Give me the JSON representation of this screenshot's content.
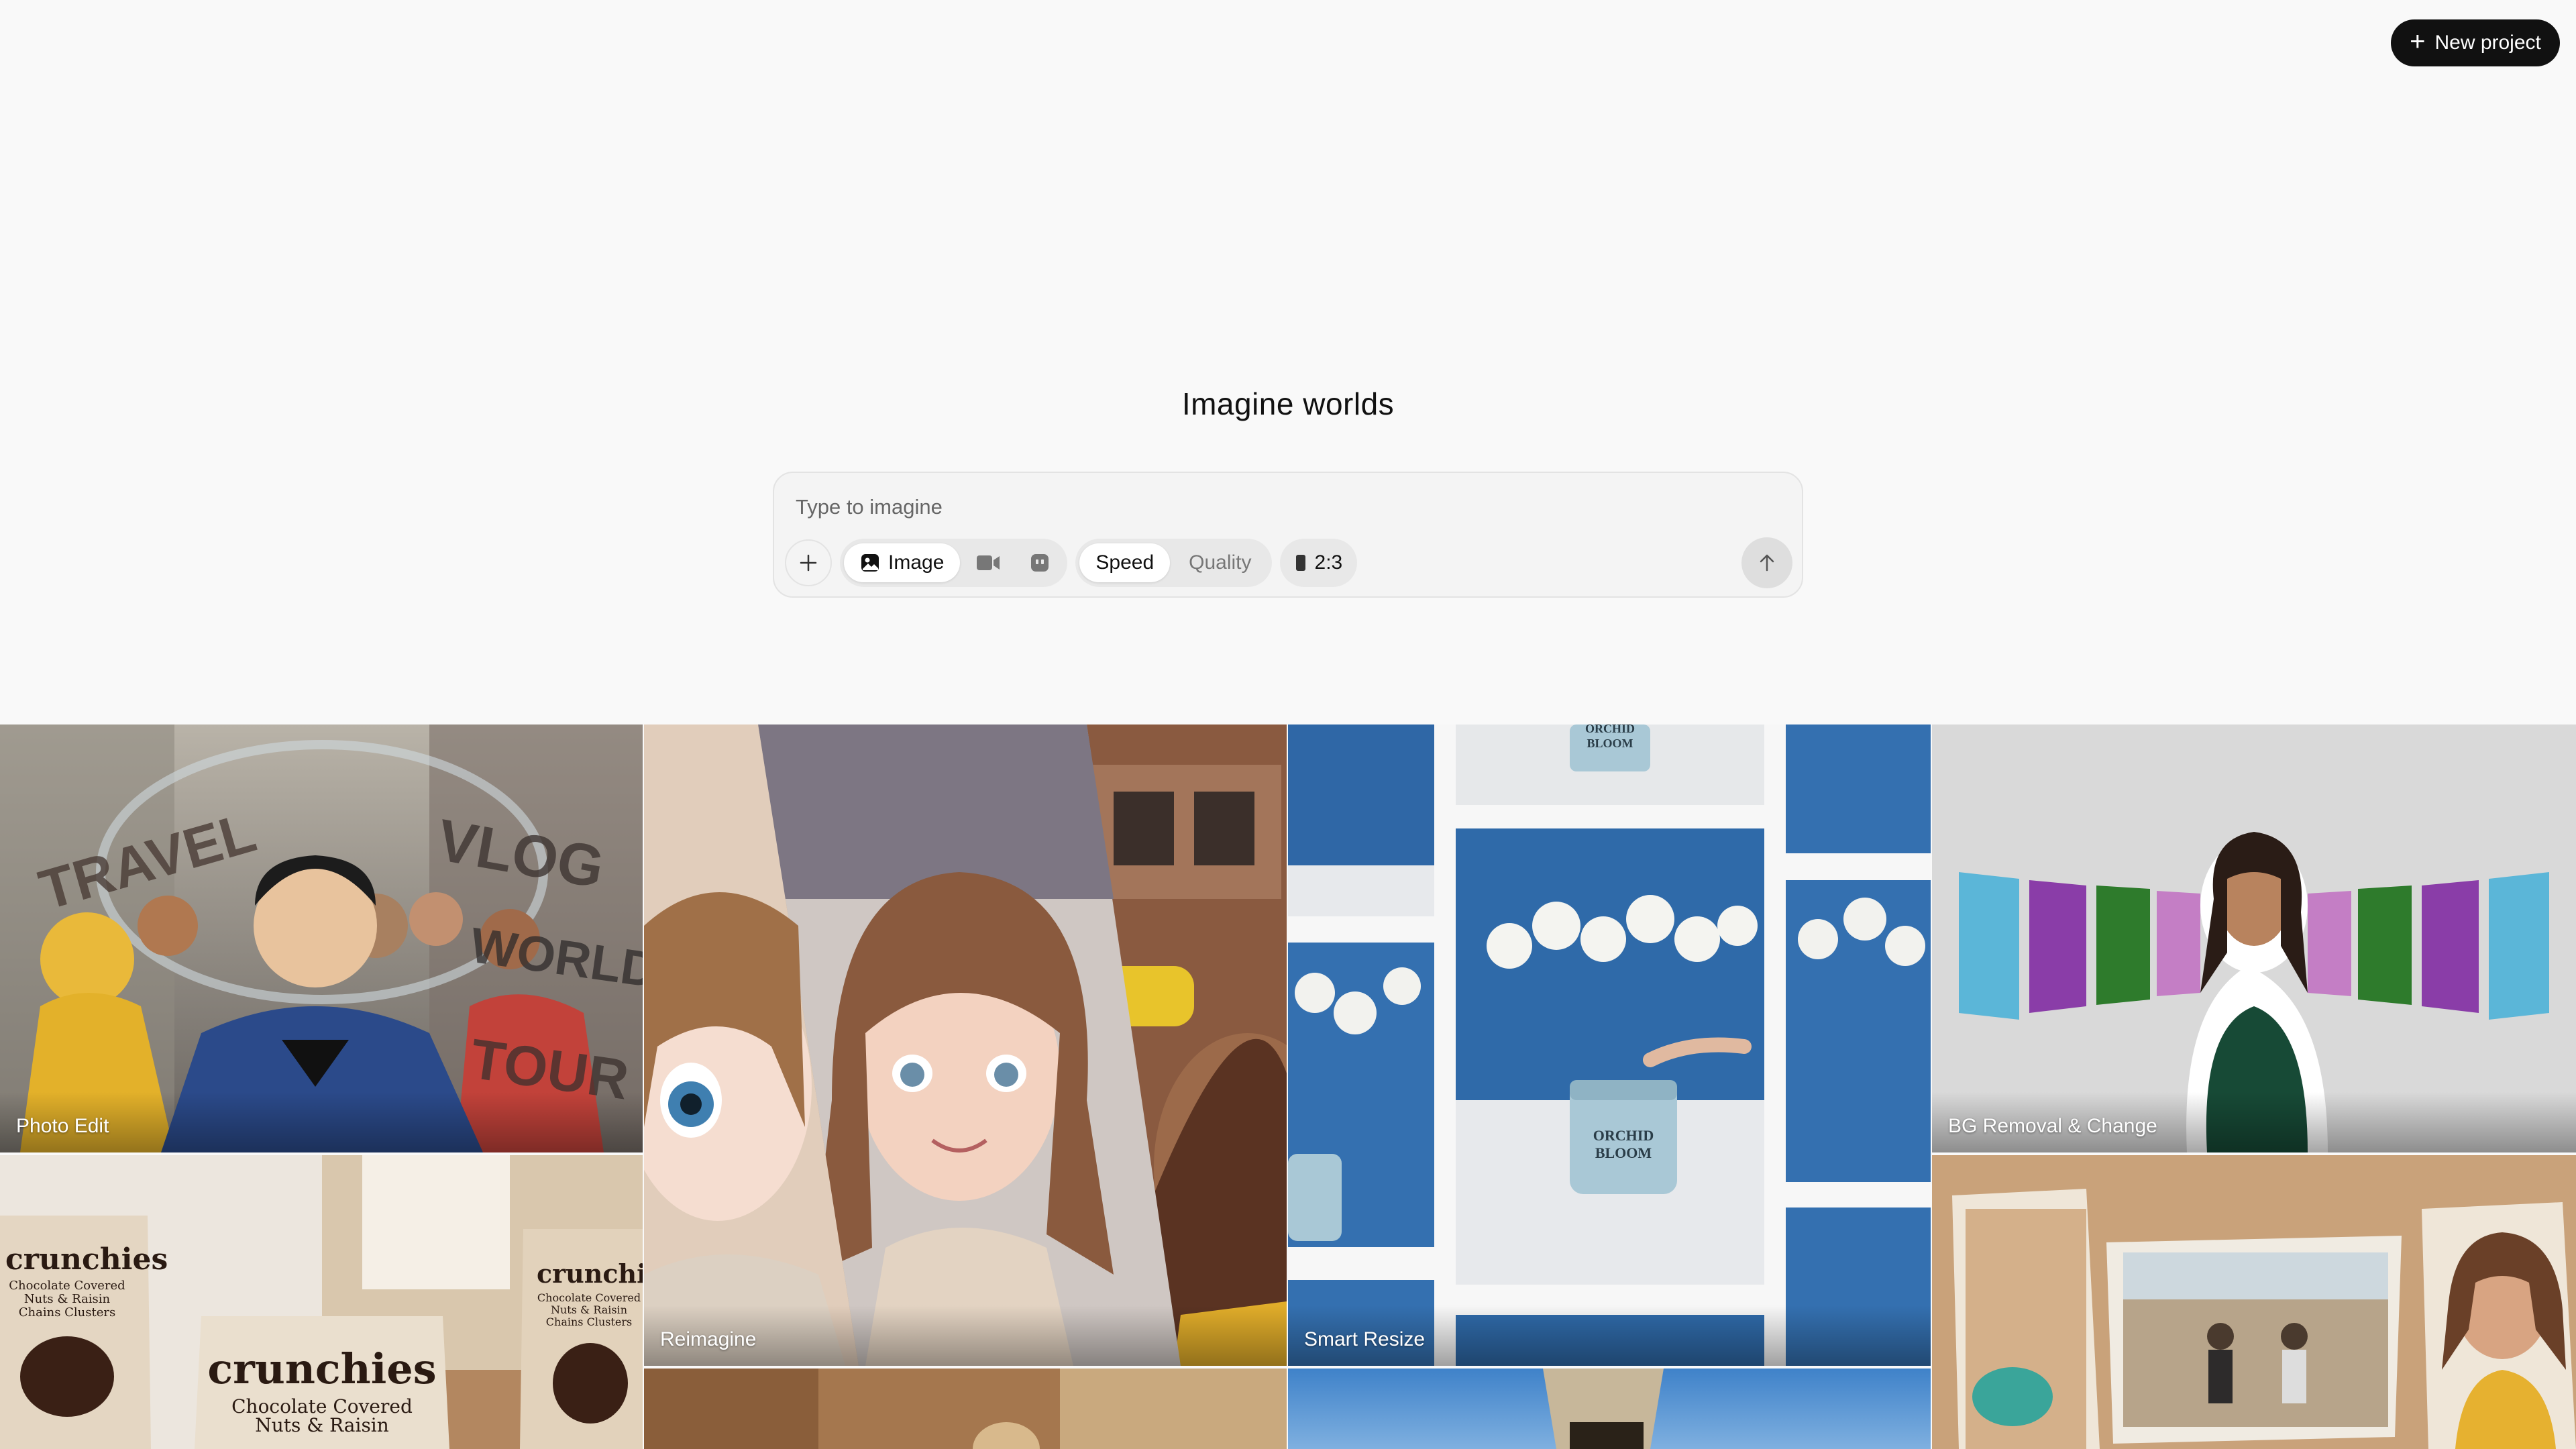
{
  "header": {
    "new_project_label": "New project"
  },
  "hero": {
    "title": "Imagine worlds"
  },
  "prompt": {
    "placeholder": "Type to imagine",
    "mode_options": [
      {
        "label": "Image",
        "icon": "image-icon",
        "selected": true
      },
      {
        "label": "",
        "icon": "video-icon",
        "selected": false
      },
      {
        "label": "",
        "icon": "character-icon",
        "selected": false
      }
    ],
    "quality_options": [
      {
        "label": "Speed",
        "selected": true
      },
      {
        "label": "Quality",
        "selected": false
      }
    ],
    "aspect_ratio": "2:3"
  },
  "gallery": {
    "tiles": [
      {
        "label": "Photo Edit"
      },
      {
        "label": "Reimagine"
      },
      {
        "label": "Smart Resize"
      },
      {
        "label": "BG Removal & Change"
      }
    ],
    "image_text": {
      "travel": "TRAVEL",
      "vlog": "VLOG",
      "world": "WORLD",
      "tour": "TOUR",
      "brand": "crunchies",
      "product_line_1": "Chocolate Covered",
      "product_line_2": "Nuts & Raisin",
      "product_line_3": "Chains Clusters",
      "jar_brand_1": "ORCHID",
      "jar_brand_2": "BLOOM"
    }
  },
  "colors": {
    "background": "#f9f9f9",
    "button_dark": "#111111",
    "segment_bg": "#e8e8e8"
  }
}
